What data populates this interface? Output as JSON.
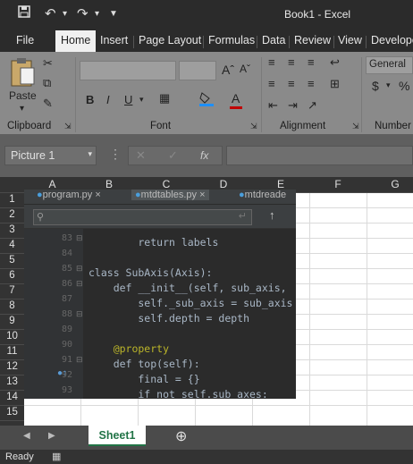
{
  "window": {
    "title": "Book1  -  Excel"
  },
  "quick_access": {
    "save_icon": "save-icon",
    "undo_icon": "undo-icon",
    "redo_icon": "redo-icon",
    "customize_icon": "customize-icon"
  },
  "ribbon_tabs": [
    "File",
    "Home",
    "Insert",
    "Page Layout",
    "Formulas",
    "Data",
    "Review",
    "View",
    "Develope"
  ],
  "ribbon": {
    "clipboard_label": "Clipboard",
    "paste_label": "Paste",
    "font_label": "Font",
    "alignment_label": "Alignment",
    "number_label": "Number",
    "number_format": "General",
    "bold": "B",
    "italic": "I",
    "underline": "U",
    "grow_font": "Aˆ",
    "shrink_font": "Aˇ",
    "font_color": "A",
    "currency": "$",
    "percent": "%"
  },
  "formula_bar": {
    "name_box": "Picture 1",
    "fx": "fx"
  },
  "columns": [
    "A",
    "B",
    "C",
    "D",
    "E",
    "F",
    "G"
  ],
  "rows": [
    "1",
    "2",
    "3",
    "4",
    "5",
    "6",
    "7",
    "8",
    "9",
    "10",
    "11",
    "12",
    "13",
    "14",
    "15"
  ],
  "picture": {
    "tabs": [
      "program.py",
      "mtdtables.py",
      "mtdreade"
    ],
    "lines": [
      {
        "n": "83",
        "text": "        return labels"
      },
      {
        "n": "84",
        "text": ""
      },
      {
        "n": "85",
        "text": "class SubAxis(Axis):"
      },
      {
        "n": "86",
        "text": "    def __init__(self, sub_axis,"
      },
      {
        "n": "87",
        "text": "        self._sub_axis = sub_axis"
      },
      {
        "n": "88",
        "text": "        self.depth = depth"
      },
      {
        "n": "89",
        "text": ""
      },
      {
        "n": "90",
        "text": "    @property"
      },
      {
        "n": "91",
        "text": "    def top(self):"
      },
      {
        "n": "92",
        "text": "        final = {}"
      },
      {
        "n": "93",
        "text": "        if not self.sub_axes:"
      }
    ]
  },
  "sheets": {
    "active": "Sheet1"
  },
  "status": {
    "text": "Ready"
  },
  "colors": {
    "excel_green": "#217346",
    "ribbon_bg": "#8a8a8a",
    "ide_bg": "#2b2b2b"
  }
}
